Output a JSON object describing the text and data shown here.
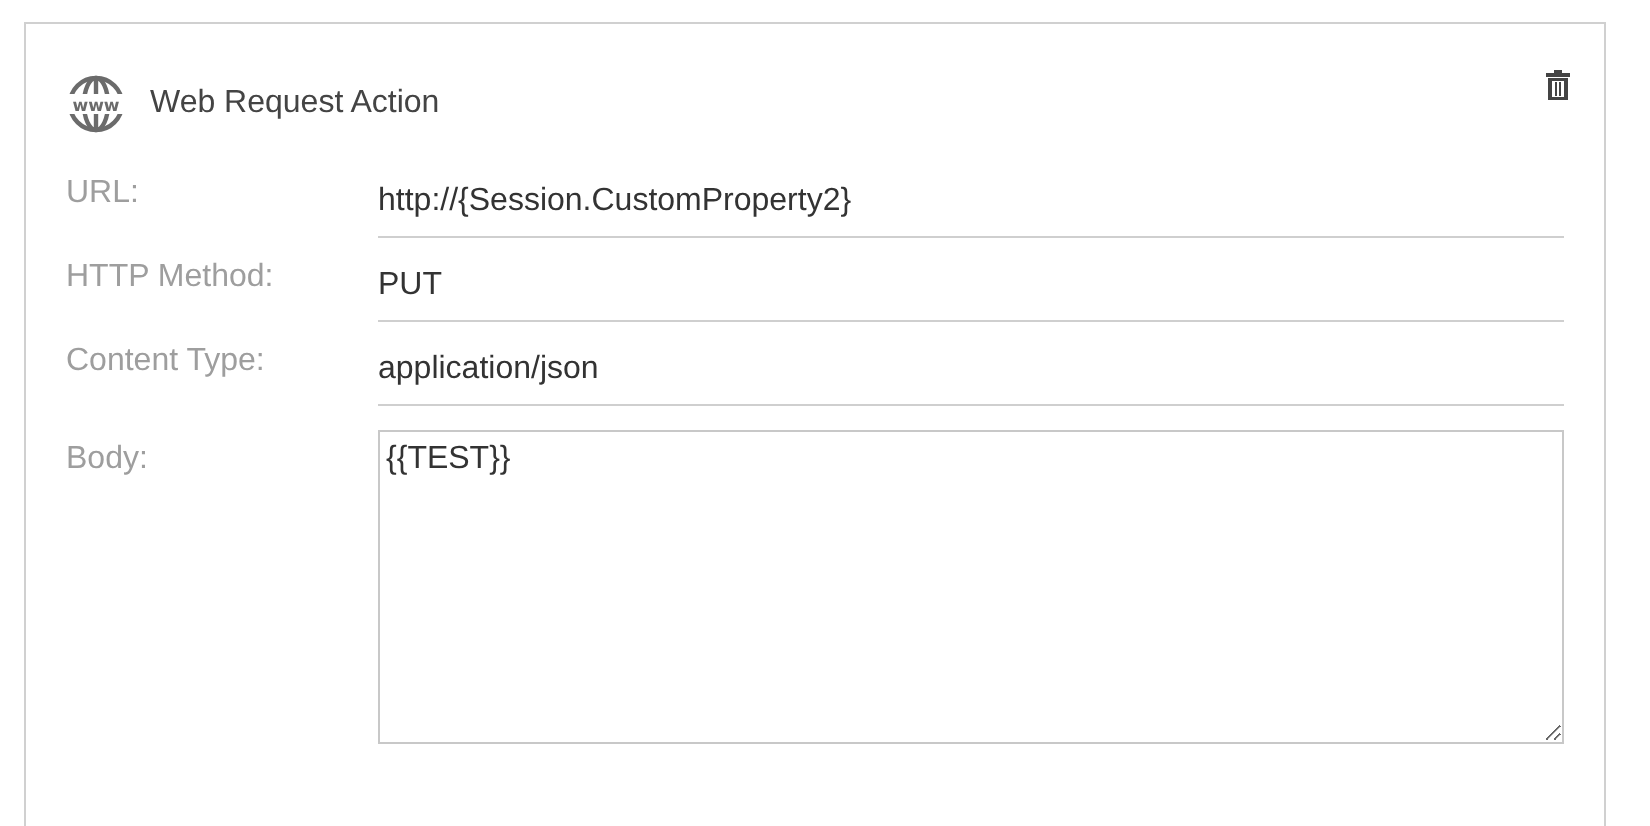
{
  "card": {
    "icon_text": "www",
    "title": "Web Request Action",
    "fields": [
      {
        "label": "URL:",
        "value": "http://{Session.CustomProperty2}",
        "kind": "line"
      },
      {
        "label": "HTTP Method:",
        "value": "PUT",
        "kind": "line"
      },
      {
        "label": "Content Type:",
        "value": "application/json",
        "kind": "line"
      },
      {
        "label": "Body:",
        "value": "{{TEST}}",
        "kind": "area"
      }
    ]
  }
}
